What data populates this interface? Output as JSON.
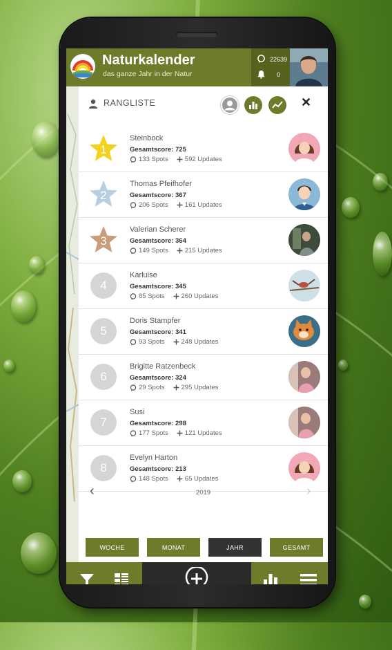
{
  "app": {
    "title": "Naturkalender",
    "subtitle": "das ganze Jahr in der Natur",
    "spots_count": "22639",
    "notifications_count": "0"
  },
  "panel": {
    "title": "RANGLISTE",
    "close_glyph": "✕"
  },
  "ranking": [
    {
      "rank": "1",
      "name": "Steinbock",
      "score": "Gesamtscore: 725",
      "spots": "133 Spots",
      "updates": "592 Updates",
      "badge": "star-gold",
      "avatar": "female-avatar"
    },
    {
      "rank": "2",
      "name": "Thomas Pfeifhofer",
      "score": "Gesamtscore: 367",
      "spots": "206 Spots",
      "updates": "161 Updates",
      "badge": "star-silver",
      "avatar": "male-avatar"
    },
    {
      "rank": "3",
      "name": "Valerian Scherer",
      "score": "Gesamtscore: 364",
      "spots": "149 Spots",
      "updates": "215 Updates",
      "badge": "star-bronze",
      "avatar": "photo-avatar"
    },
    {
      "rank": "4",
      "name": "Karluise",
      "score": "Gesamtscore: 345",
      "spots": "85 Spots",
      "updates": "260 Updates",
      "badge": "circle",
      "avatar": "bird-photo-avatar"
    },
    {
      "rank": "5",
      "name": "Doris Stampfer",
      "score": "Gesamtscore: 341",
      "spots": "93 Spots",
      "updates": "248 Updates",
      "badge": "circle",
      "avatar": "cat-photo-avatar"
    },
    {
      "rank": "6",
      "name": "Brigitte Ratzenbeck",
      "score": "Gesamtscore: 324",
      "spots": "29 Spots",
      "updates": "295 Updates",
      "badge": "circle",
      "avatar": "person-photo-avatar"
    },
    {
      "rank": "7",
      "name": "Susi",
      "score": "Gesamtscore: 298",
      "spots": "177 Spots",
      "updates": "121 Updates",
      "badge": "circle",
      "avatar": "person-photo-avatar"
    },
    {
      "rank": "8",
      "name": "Evelyn Harton",
      "score": "Gesamtscore: 213",
      "spots": "148 Spots",
      "updates": "65 Updates",
      "badge": "circle",
      "avatar": "female-avatar"
    }
  ],
  "pager": {
    "year": "2019",
    "prev_glyph": "‹",
    "next_glyph": "›"
  },
  "periods": {
    "week": "WOCHE",
    "month": "MONAT",
    "year": "JAHR",
    "total": "GESAMT",
    "active": "year"
  },
  "colors": {
    "brand_green": "#6c7c2a",
    "dark_green": "#55631f",
    "gold": "#f2d21b",
    "silver": "#b8cfe0",
    "bronze": "#c99c7b",
    "rank_circle": "#d5d5d5"
  }
}
